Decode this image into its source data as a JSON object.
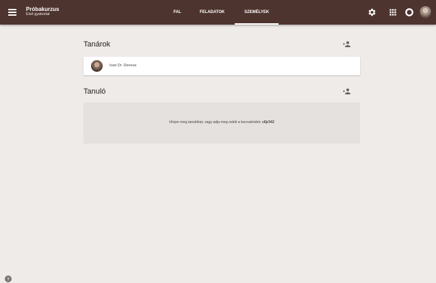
{
  "header": {
    "course_title": "Próbakurzus",
    "course_subtitle": "Első gyakorlat",
    "tabs": [
      {
        "label": "FAL",
        "active": false
      },
      {
        "label": "FELADATOK",
        "active": false
      },
      {
        "label": "SZEMÉLYEK",
        "active": true
      }
    ],
    "icons": [
      "menu-icon",
      "gear-icon",
      "apps-icon",
      "notifications-icon",
      "avatar"
    ]
  },
  "teachers": {
    "title": "Tanárok",
    "items": [
      {
        "name": "Ivan Dr. Devosa"
      }
    ]
  },
  "students": {
    "title": "Tanuló",
    "empty_text": "Hívjon meg tanulókat, vagy adja meg nekik a kurzuskódot: ",
    "course_code": "c6jr342"
  },
  "colors": {
    "header_bg": "#4e342e",
    "page_bg": "#efebe9",
    "empty_bg": "#e4e1df"
  }
}
